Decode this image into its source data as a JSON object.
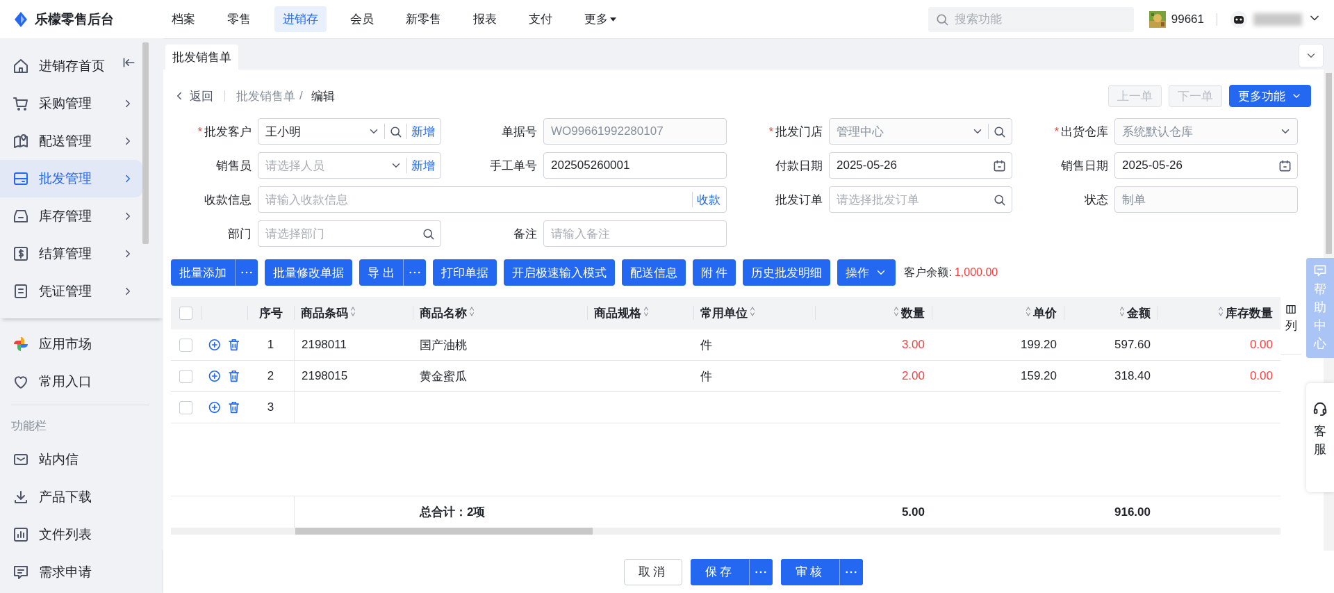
{
  "brand": {
    "name": "乐檬零售后台"
  },
  "top_nav": [
    {
      "label": "档案",
      "selected": false,
      "kind": "link"
    },
    {
      "label": "零售",
      "selected": false,
      "kind": "link"
    },
    {
      "label": "进销存",
      "selected": true,
      "kind": "link"
    },
    {
      "label": "会员",
      "selected": false,
      "kind": "link"
    },
    {
      "label": "新零售",
      "selected": false,
      "kind": "link"
    },
    {
      "label": "报表",
      "selected": false,
      "kind": "link"
    },
    {
      "label": "支付",
      "selected": false,
      "kind": "link"
    },
    {
      "label": "更多",
      "selected": false,
      "kind": "dropdown"
    }
  ],
  "search": {
    "placeholder": "搜索功能"
  },
  "account": {
    "store_id": "99661"
  },
  "sidebar": {
    "modules": [
      {
        "label": "进销存首页",
        "selected": false,
        "expandable": false
      },
      {
        "label": "采购管理",
        "selected": false,
        "expandable": true
      },
      {
        "label": "配送管理",
        "selected": false,
        "expandable": true
      },
      {
        "label": "批发管理",
        "selected": true,
        "expandable": true
      },
      {
        "label": "库存管理",
        "selected": false,
        "expandable": true
      },
      {
        "label": "结算管理",
        "selected": false,
        "expandable": true
      },
      {
        "label": "凭证管理",
        "selected": false,
        "expandable": true
      }
    ],
    "shortcuts": [
      {
        "label": "应用市场"
      },
      {
        "label": "常用入口"
      }
    ],
    "section_title": "功能栏",
    "tools": [
      {
        "label": "站内信"
      },
      {
        "label": "产品下载"
      },
      {
        "label": "文件列表"
      },
      {
        "label": "需求申请"
      }
    ]
  },
  "tabs": [
    {
      "label": "批发销售单",
      "selected": true
    }
  ],
  "breadcrumb": {
    "back": "返回",
    "path": [
      "批发销售单",
      "编辑"
    ],
    "separator": "/"
  },
  "nav_buttons": [
    {
      "label": "上一单",
      "kind": "plain",
      "disabled": true
    },
    {
      "label": "下一单",
      "kind": "plain",
      "disabled": true
    },
    {
      "label": "更多功能",
      "kind": "dropdown",
      "disabled": false
    }
  ],
  "form": [
    {
      "label": "批发客户",
      "marker": "*",
      "kind": "select-search",
      "value": "王小明",
      "action": "新增",
      "disabled": false
    },
    {
      "label": "单据号",
      "kind": "text",
      "value": "WO99661992280107",
      "disabled": true
    },
    {
      "label": "批发门店",
      "marker": "*",
      "kind": "select-search",
      "value": "管理中心",
      "disabled": true
    },
    {
      "label": "出货仓库",
      "marker": "*",
      "kind": "select",
      "value": "系统默认仓库",
      "disabled": true
    },
    {
      "label": "销售员",
      "kind": "select",
      "placeholder": "请选择人员",
      "action": "新增",
      "disabled": false
    },
    {
      "label": "手工单号",
      "kind": "text",
      "value": "202505260001",
      "disabled": false
    },
    {
      "label": "付款日期",
      "kind": "date",
      "value": "2025-05-26",
      "disabled": false
    },
    {
      "label": "销售日期",
      "kind": "date",
      "value": "2025-05-26",
      "disabled": false
    },
    {
      "label": "收款信息",
      "kind": "wide-text",
      "placeholder": "请输入收款信息",
      "action": "收款",
      "disabled": false
    },
    {
      "label": "批发订单",
      "kind": "search",
      "placeholder": "请选择批发订单",
      "disabled": false
    },
    {
      "label": "状态",
      "kind": "text",
      "value": "制单",
      "disabled": true
    },
    {
      "label": "部门",
      "kind": "search",
      "placeholder": "请选择部门",
      "disabled": false
    },
    {
      "label": "备注",
      "kind": "text",
      "placeholder": "请输入备注",
      "disabled": false
    }
  ],
  "toolbar": [
    {
      "label": "批量添加",
      "kind": "split"
    },
    {
      "label": "批量修改单据",
      "kind": "plain"
    },
    {
      "label": "导 出",
      "kind": "split"
    },
    {
      "label": "打印单据",
      "kind": "plain"
    },
    {
      "label": "开启极速输入模式",
      "kind": "plain"
    },
    {
      "label": "配送信息",
      "kind": "plain"
    },
    {
      "label": "附 件",
      "kind": "plain"
    },
    {
      "label": "历史批发明细",
      "kind": "plain"
    },
    {
      "label": "操作",
      "kind": "dropdown"
    }
  ],
  "balance": {
    "label": "客户余额:",
    "value": "1,000.00"
  },
  "table": {
    "header_checked": false,
    "columns": [
      {
        "label": "序号",
        "kind": "index",
        "sortable": false
      },
      {
        "label": "商品条码",
        "kind": "text",
        "sortable": true
      },
      {
        "label": "商品名称",
        "kind": "text",
        "sortable": true
      },
      {
        "label": "商品规格",
        "kind": "text",
        "sortable": true
      },
      {
        "label": "常用单位",
        "kind": "text",
        "sortable": true
      },
      {
        "label": "数量",
        "kind": "alert-number",
        "sortable": true
      },
      {
        "label": "单价",
        "kind": "number",
        "sortable": true
      },
      {
        "label": "金额",
        "kind": "number",
        "sortable": true
      },
      {
        "label": "库存数量",
        "kind": "alert-number",
        "sortable": true
      }
    ],
    "rows": [
      {
        "checked": false,
        "cells": {
          "seq": "1",
          "barcode": "2198011",
          "name": "国产油桃",
          "unit": "件",
          "qty": "3.00",
          "price": "199.20",
          "amount": "597.60",
          "stock": "0.00"
        }
      },
      {
        "checked": false,
        "cells": {
          "seq": "2",
          "barcode": "2198015",
          "name": "黄金蜜瓜",
          "unit": "件",
          "qty": "2.00",
          "price": "159.20",
          "amount": "318.40",
          "stock": "0.00"
        }
      },
      {
        "checked": false,
        "cells": {
          "seq": "3"
        }
      }
    ],
    "totals": {
      "name": "总合计：2项",
      "qty": "5.00",
      "amount": "916.00"
    },
    "column_settings": "列"
  },
  "help": {
    "label": "帮助中心"
  },
  "service": {
    "label": "客服"
  },
  "footer_buttons": [
    {
      "label": "取消",
      "kind": "plain"
    },
    {
      "label": "保存",
      "kind": "split"
    },
    {
      "label": "审核",
      "kind": "split"
    }
  ]
}
